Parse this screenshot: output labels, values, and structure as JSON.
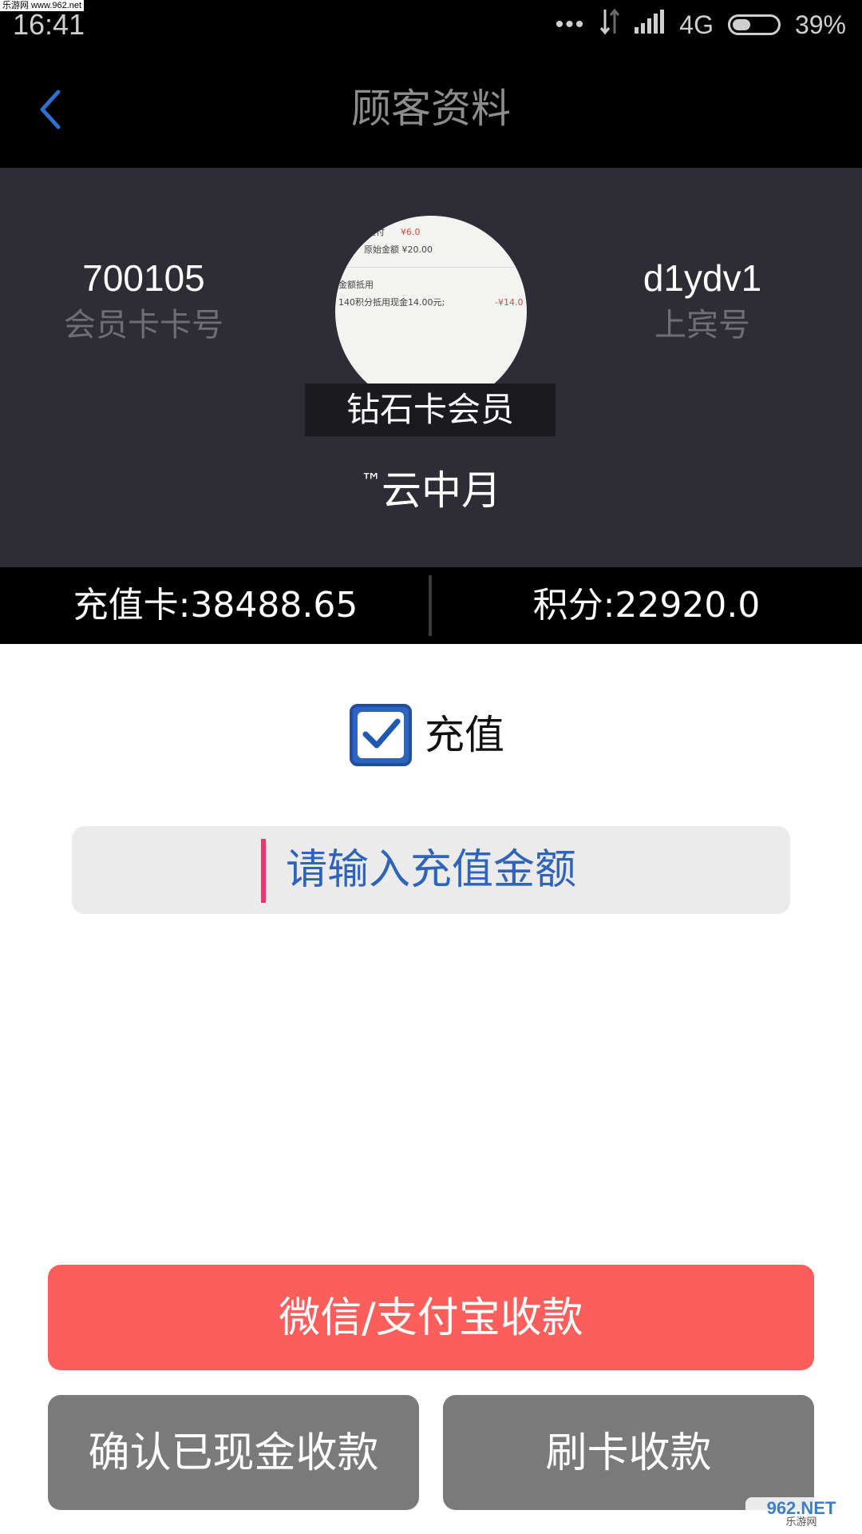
{
  "watermark_top": "乐游网 www.962.net",
  "status_bar": {
    "time": "16:41",
    "dots": "•••",
    "network": "4G",
    "battery": "39%"
  },
  "header": {
    "title": "顾客资料"
  },
  "profile": {
    "card_number": "700105",
    "card_number_label": "会员卡卡号",
    "guest_number": "d1ydv1",
    "guest_number_label": "上宾号",
    "level": "钻石卡会员",
    "name_prefix": "™",
    "name": "云中月",
    "avatar_lines": {
      "line1_label": "支付",
      "line1_value": "¥6.0",
      "line2": "原始金额 ¥20.00",
      "line3": "金额抵用",
      "line4": "140积分抵用现金14.00元;",
      "line4_value": "-¥14.0"
    }
  },
  "balance": {
    "recharge_card": "充值卡:38488.65",
    "points": "积分:22920.0"
  },
  "recharge": {
    "label": "充值",
    "checked": true,
    "amount_placeholder": "请输入充值金额"
  },
  "actions": {
    "wechat_alipay": "微信/支付宝收款",
    "cash_confirm": "确认已现金收款",
    "card_pay": "刷卡收款"
  },
  "watermark_logo": {
    "top": "962.NET",
    "bottom": "乐游网"
  }
}
